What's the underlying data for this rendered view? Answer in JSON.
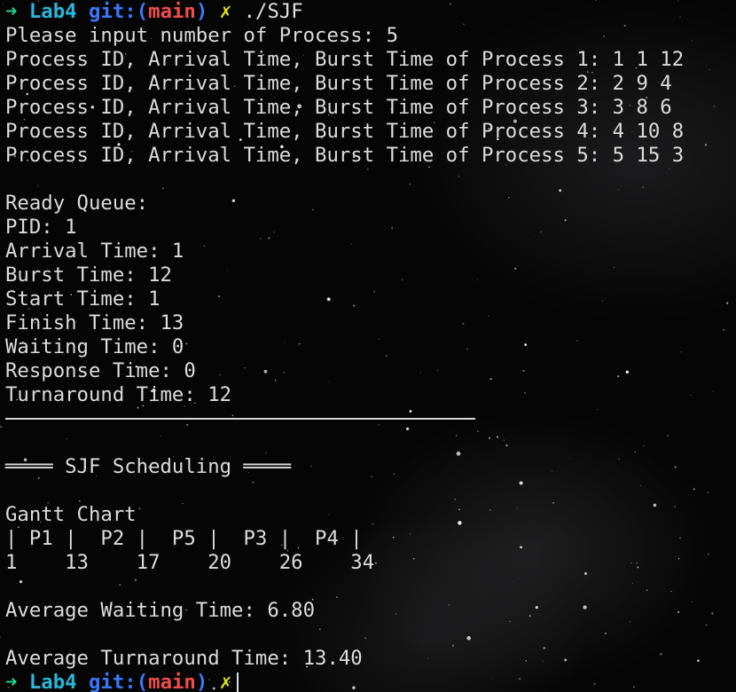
{
  "prompt": {
    "arrow": "➜",
    "dir": "Lab4",
    "git_prefix": "git:(",
    "branch": "main",
    "git_suffix": ")",
    "dirty_mark": "✗"
  },
  "command": "./SJF",
  "output_before_divider": [
    "Please input number of Process: 5",
    "Process ID, Arrival Time, Burst Time of Process 1: 1 1 12",
    "Process ID, Arrival Time, Burst Time of Process 2: 2 9 4",
    "Process ID, Arrival Time, Burst Time of Process 3: 3 8 6",
    "Process ID, Arrival Time, Burst Time of Process 4: 4 10 8",
    "Process ID, Arrival Time, Burst Time of Process 5: 5 15 3",
    "",
    "Ready Queue:",
    "PID: 1",
    "Arrival Time: 1",
    "Burst Time: 12",
    "Start Time: 1",
    "Finish Time: 13",
    "Waiting Time: 0",
    "Response Time: 0",
    "Turnaround Time: 12"
  ],
  "output_after_divider": [
    "",
    "════ SJF Scheduling ════",
    "",
    "Gantt Chart",
    "| P1 |  P2 |  P5 |  P3 |  P4 |",
    "1    13    17    20    26    34",
    "",
    "Average Waiting Time: 6.80",
    "",
    "Average Turnaround Time: 13.40"
  ]
}
